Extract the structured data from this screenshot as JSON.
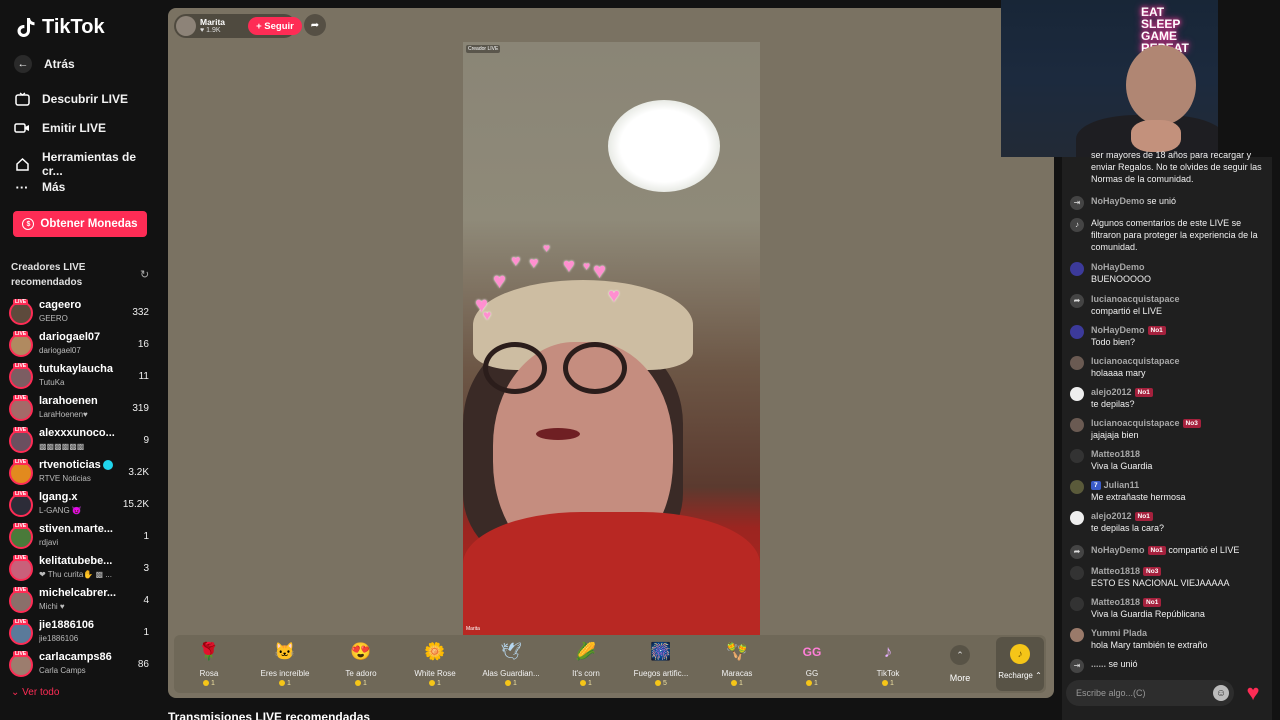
{
  "brand": {
    "name": "TikTok"
  },
  "nav": {
    "back": "Atrás",
    "items": [
      {
        "label": "Descubrir LIVE",
        "icon": "tv-icon"
      },
      {
        "label": "Emitir LIVE",
        "icon": "camera-icon"
      },
      {
        "label": "Herramientas de cr...",
        "icon": "home-icon"
      },
      {
        "label": "Más",
        "icon": "more-icon"
      }
    ],
    "coins_button": "Obtener Monedas"
  },
  "recommended": {
    "title": "Creadores LIVE recomendados",
    "creators": [
      {
        "name": "cageero",
        "sub": "GEERO",
        "count": "332"
      },
      {
        "name": "dariogael07",
        "sub": "dariogael07",
        "count": "16"
      },
      {
        "name": "tutukaylaucha",
        "sub": "TutuKa",
        "count": "11"
      },
      {
        "name": "larahoenen",
        "sub": "LaraHoenen♥",
        "count": "319"
      },
      {
        "name": "alexxxunoco...",
        "sub": "▩▩▩▩▩▩",
        "count": "9"
      },
      {
        "name": "rtvenoticias",
        "sub": "RTVE Noticias",
        "count": "3.2K",
        "verified": true
      },
      {
        "name": "lgang.x",
        "sub": "L-GANG 😈",
        "count": "15.2K"
      },
      {
        "name": "stiven.marte...",
        "sub": "rdjavi",
        "count": "1"
      },
      {
        "name": "kelitatubebe...",
        "sub": "❤ Thu curita✋ ▩ ...",
        "count": "3"
      },
      {
        "name": "michelcabrer...",
        "sub": "Michi ♥",
        "count": "4"
      },
      {
        "name": "jie1886106",
        "sub": "jie1886106",
        "count": "1"
      },
      {
        "name": "carlacamps86",
        "sub": "Carla Camps",
        "count": "86"
      }
    ],
    "see_all": "Ver todo"
  },
  "stream": {
    "host_name": "Marita",
    "host_likes": "1.9K",
    "follow_label": "+ Seguir",
    "video_tag": "Creador LIVE",
    "video_name": "Marita"
  },
  "gifts": [
    {
      "name": "Rosa",
      "price": "1",
      "icon": "🌹",
      "color": "#e03a4e"
    },
    {
      "name": "Eres increíble",
      "price": "1",
      "icon": "🐱",
      "color": "#c89a70"
    },
    {
      "name": "Te adoro",
      "price": "1",
      "icon": "😍",
      "color": "#e04848"
    },
    {
      "name": "White Rose",
      "price": "1",
      "icon": "🌼",
      "color": "#e8e8d8"
    },
    {
      "name": "Alas Guardian...",
      "price": "1",
      "icon": "🕊",
      "color": "#b7d8f0"
    },
    {
      "name": "It's corn",
      "price": "1",
      "icon": "🌽",
      "color": "#f2c230"
    },
    {
      "name": "Fuegos artific...",
      "price": "5",
      "icon": "🎆",
      "color": "#9a7cf0"
    },
    {
      "name": "Maracas",
      "price": "1",
      "icon": "🪇",
      "color": "#d84b3c"
    },
    {
      "name": "GG",
      "price": "1",
      "icon": "GG",
      "color": "#f07fd0"
    },
    {
      "name": "TikTok",
      "price": "1",
      "icon": "♪",
      "color": "#e7b0ff"
    }
  ],
  "gift_more": "More",
  "recharge_label": "Recharge",
  "section_title": "Transmisiones LIVE recomendadas",
  "webcam": {
    "neon_line1": "EAT",
    "neon_line2": "SLEEP",
    "neon_line3": "GAME",
    "neon_line4": "REPEAT"
  },
  "chat": {
    "intro_text": "ser mayores de 18 años para recargar y enviar Regalos. No te olvides de seguir las Normas de la comunidad.",
    "messages": [
      {
        "user": "NoHayDemo",
        "text": "se unió",
        "inline": true,
        "icon": "join-icon"
      },
      {
        "user": "",
        "text": "Algunos comentarios de este LIVE se filtraron para proteger la experiencia de la comunidad.",
        "icon": "tiktok-icon"
      },
      {
        "user": "NoHayDemo",
        "text": "BUENOOOOO"
      },
      {
        "user": "lucianoacquistapace",
        "text": "compartió el LIVE",
        "icon": "share-icon"
      },
      {
        "user": "NoHayDemo",
        "badge": "No1",
        "text": "Todo bien?"
      },
      {
        "user": "lucianoacquistapace",
        "text": "holaaaa mary"
      },
      {
        "user": "alejo2012",
        "badge": "No1",
        "text": "te depilas?"
      },
      {
        "user": "lucianoacquistapace",
        "badge": "No3",
        "text": "jajajaja bien"
      },
      {
        "user": "Matteo1818",
        "text": "Viva la Guardia"
      },
      {
        "user": "Julian11",
        "level": "7",
        "text": "Me extrañaste hermosa"
      },
      {
        "user": "alejo2012",
        "badge": "No1",
        "text": "te depilas la cara?"
      },
      {
        "user": "NoHayDemo",
        "badge": "No1",
        "text": "compartió el LIVE",
        "inline": true,
        "icon": "share-icon"
      },
      {
        "user": "Matteo1818",
        "badge": "No3",
        "text": "ESTO ES NACIONAL VIEJAAAAA"
      },
      {
        "user": "Matteo1818",
        "badge": "No1",
        "text": "Viva la Guardia Repúblicana"
      },
      {
        "user": "Yummi Plada",
        "text": "hola Mary también te extraño"
      },
      {
        "user": "......",
        "text": "se unió",
        "inline": true,
        "icon": "join-icon"
      }
    ],
    "input_placeholder": "Escribe algo...(C)"
  }
}
